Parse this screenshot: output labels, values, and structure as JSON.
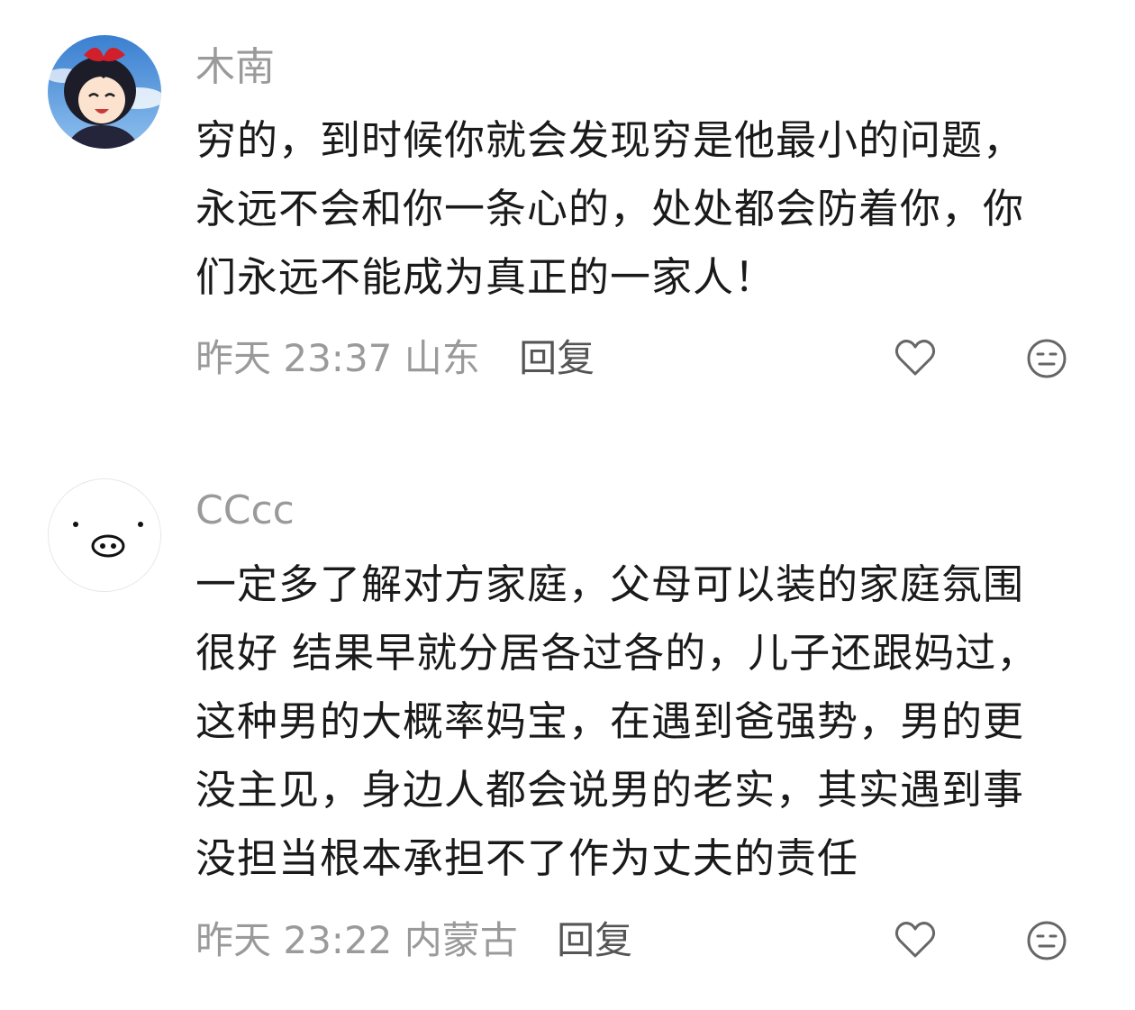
{
  "comments": [
    {
      "username": "木南",
      "lines": [
        "穷的，到时候你就会发现穷是他最小的问题，",
        "永远不会和你一条心的，处处都会防着你，你",
        "们永远不能成为真正的一家人！"
      ],
      "time": "昨天 23:37",
      "location": "山东",
      "reply_label": "回复"
    },
    {
      "username": "CCcc",
      "lines": [
        "一定多了解对方家庭，父母可以装的家庭氛围",
        "很好 结果早就分居各过各的，儿子还跟妈过，",
        "这种男的大概率妈宝，在遇到爸强势，男的更",
        "没主见，身边人都会说男的老实，其实遇到事",
        "没担当根本承担不了作为丈夫的责任"
      ],
      "time": "昨天 23:22",
      "location": "内蒙古",
      "reply_label": "回复"
    }
  ],
  "icons": {
    "like": "heart-icon",
    "dislike": "meh-face-icon"
  }
}
